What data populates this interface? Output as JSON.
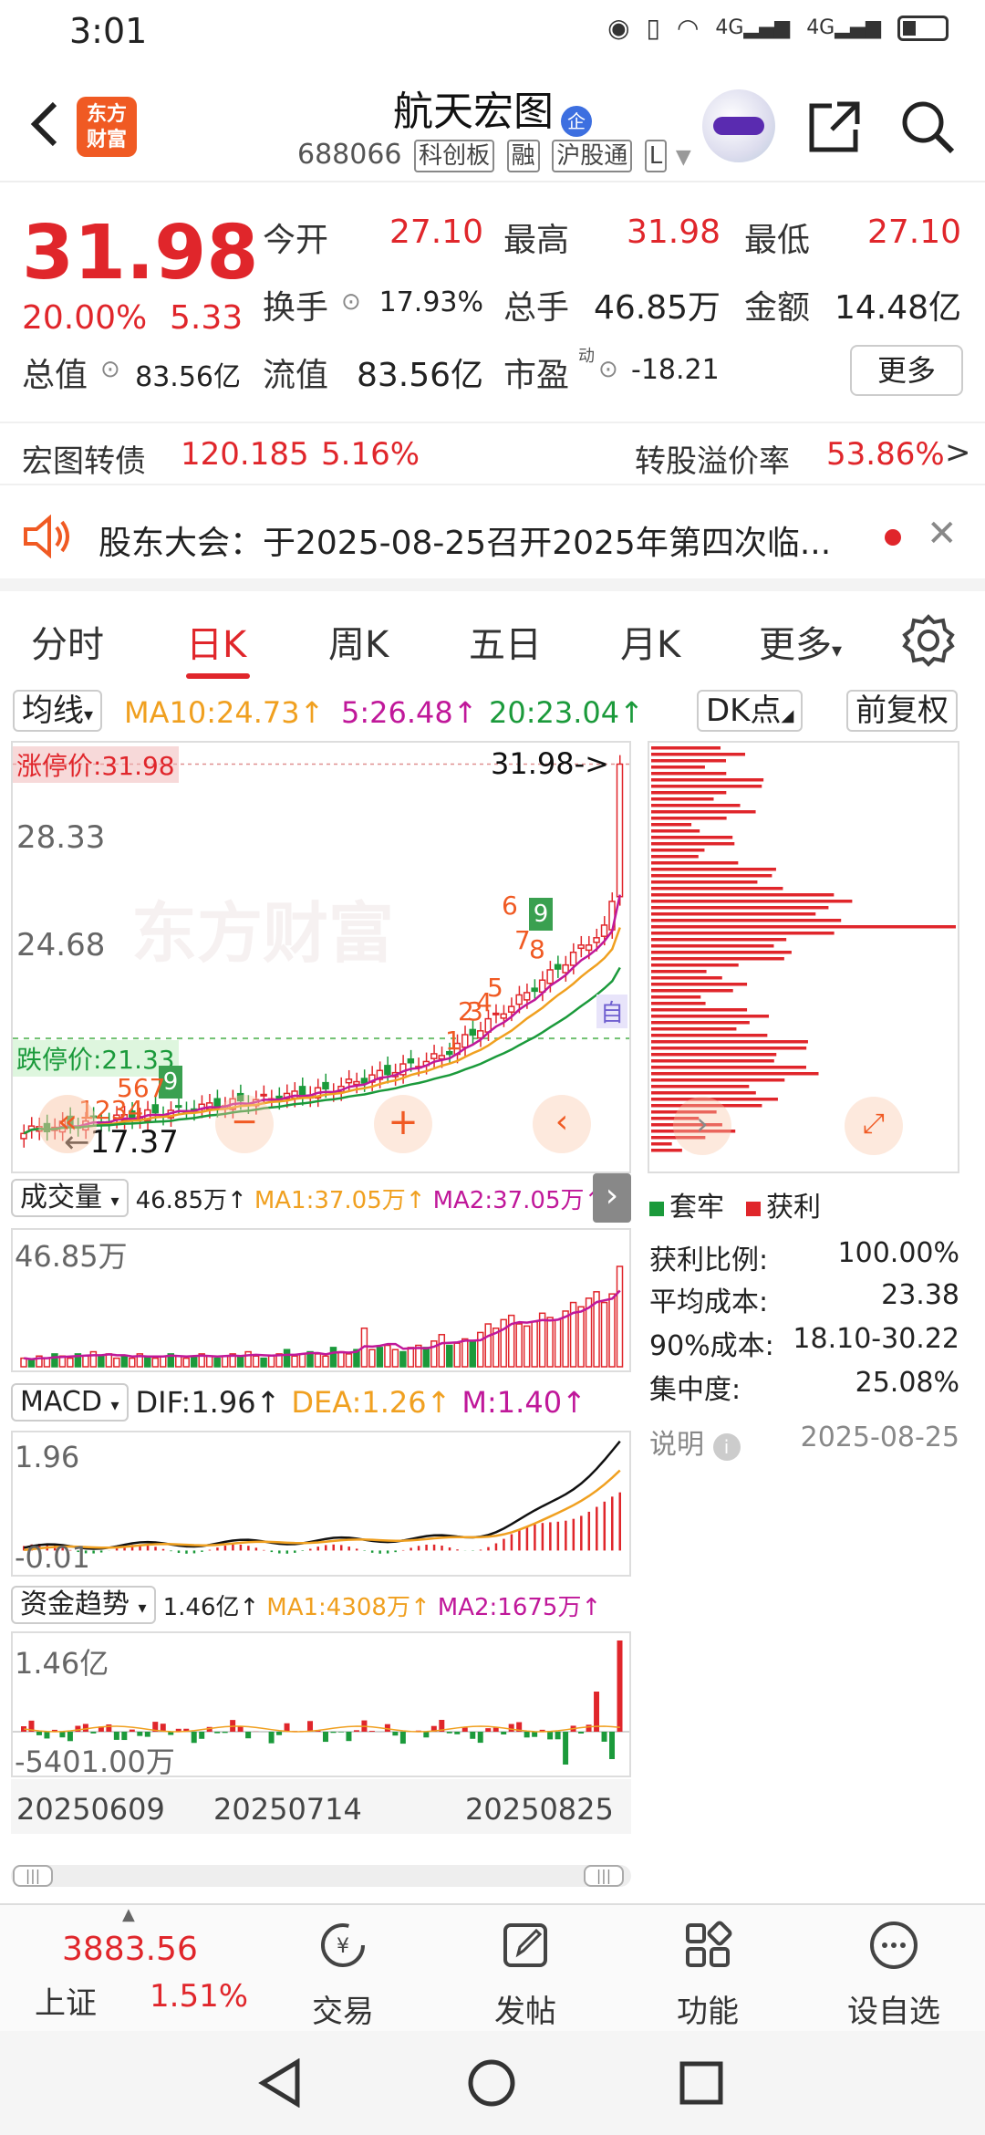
{
  "status_bar": {
    "time": "3:01",
    "net1": "4G",
    "net2": "4G"
  },
  "header": {
    "logo_line1": "东方",
    "logo_line2": "财富",
    "stock_name": "航天宏图",
    "name_badge": "企",
    "code": "688066",
    "tags": [
      "科创板",
      "融",
      "沪股通",
      "L"
    ]
  },
  "quote": {
    "price": "31.98",
    "change_pct": "20.00%",
    "change_amt": "5.33",
    "open_label": "今开",
    "open": "27.10",
    "high_label": "最高",
    "high": "31.98",
    "low_label": "最低",
    "low": "27.10",
    "turnover_label": "换手",
    "turnover": "17.93%",
    "volume_label": "总手",
    "volume": "46.85万",
    "amount_label": "金额",
    "amount": "14.48亿",
    "mktcap_label": "总值",
    "mktcap": "83.56亿",
    "float_label": "流值",
    "float_cap": "83.56亿",
    "pe_label": "市盈",
    "pe_sup": "动",
    "pe": "-18.21",
    "more": "更多"
  },
  "convert_bond": {
    "label": "宏图转债",
    "price": "120.185",
    "pct": "5.16%",
    "premium_label": "转股溢价率",
    "premium": "53.86%",
    "arrow": ">"
  },
  "notice": {
    "text": "股东大会：于2025-08-25召开2025年第四次临..."
  },
  "tabs": [
    "分时",
    "日K",
    "周K",
    "五日",
    "月K",
    "更多"
  ],
  "ma_row": {
    "select": "均线",
    "ma10": "MA10:24.73↑",
    "ma5": "5:26.48↑",
    "ma20": "20:23.04↑",
    "dk": "DK点",
    "adjust": "前复权"
  },
  "main_chart": {
    "price_top_label": "涨停价:31.98",
    "arrow_label": "31.98->",
    "y_labels": [
      "28.33",
      "24.68"
    ],
    "limit_down_label": "跌停价:21.33",
    "low_label": "17.37",
    "watermark": "东方财富",
    "self_marker": "自",
    "nine_labels": [
      "9",
      "9"
    ],
    "seq_labels": [
      "1",
      "2",
      "3",
      "4",
      "5",
      "6",
      "7",
      "8",
      "1",
      "2",
      "3",
      "4",
      "5",
      "6",
      "7"
    ]
  },
  "chart_data": [
    {
      "type": "bar",
      "title": "成交量",
      "ylim": [
        0,
        46.85
      ],
      "unit": "万",
      "series": [
        {
          "name": "成交量",
          "values": [
            4,
            3,
            5,
            4,
            6,
            5,
            4,
            6,
            5,
            7,
            5,
            6,
            4,
            5,
            4,
            6,
            5,
            4,
            5,
            6,
            5,
            4,
            5,
            6,
            5,
            4,
            5,
            6,
            5,
            7,
            5,
            4,
            5,
            6,
            8,
            5,
            6,
            7,
            6,
            5,
            9,
            7,
            6,
            8,
            18,
            8,
            9,
            10,
            8,
            7,
            9,
            10,
            9,
            12,
            15,
            10,
            11,
            13,
            12,
            16,
            20,
            18,
            22,
            24,
            20,
            19,
            21,
            25,
            23,
            22,
            26,
            30,
            28,
            32,
            35,
            30,
            34,
            46.85
          ]
        }
      ]
    },
    {
      "type": "bar",
      "title": "MACD",
      "ylim": [
        -0.01,
        1.96
      ]
    },
    {
      "type": "bar",
      "title": "资金趋势",
      "ylim": [
        -5401,
        14600
      ],
      "x_ticks": [
        "20250609",
        "20250714",
        "20250825"
      ]
    }
  ],
  "volume_head": {
    "select": "成交量",
    "v": "46.85万↑",
    "ma1": "MA1:37.05万↑",
    "ma2": "MA2:37.05万↑",
    "top": "46.85万"
  },
  "macd_head": {
    "select": "MACD",
    "dif": "DIF:1.96↑",
    "dea": "DEA:1.26↑",
    "m": "M:1.40↑",
    "top": "1.96",
    "bottom": "-0.01"
  },
  "fund_head": {
    "select": "资金趋势",
    "v": "1.46亿↑",
    "ma1": "MA1:4308万↑",
    "ma2": "MA2:1675万↑",
    "top": "1.46亿",
    "bottom": "-5401.00万"
  },
  "x_axis": [
    "20250609",
    "20250714",
    "20250825"
  ],
  "chips": {
    "legend_trap": "套牢",
    "legend_profit": "获利",
    "profit_ratio_label": "获利比例:",
    "profit_ratio": "100.00%",
    "avg_cost_label": "平均成本:",
    "avg_cost": "23.38",
    "cost90_label": "90%成本:",
    "cost90": "18.10-30.22",
    "concentration_label": "集中度:",
    "concentration": "25.08%",
    "note_label": "说明",
    "date": "2025-08-25"
  },
  "bottom_nav": {
    "index_value": "3883.56",
    "index_name": "上证",
    "index_pct": "1.51%",
    "trade": "交易",
    "post": "发帖",
    "func": "功能",
    "watch": "设自选"
  },
  "colors": {
    "red": "#e0262b",
    "green": "#1b9a3b",
    "orange": "#f0a020",
    "magenta": "#c0189a"
  }
}
